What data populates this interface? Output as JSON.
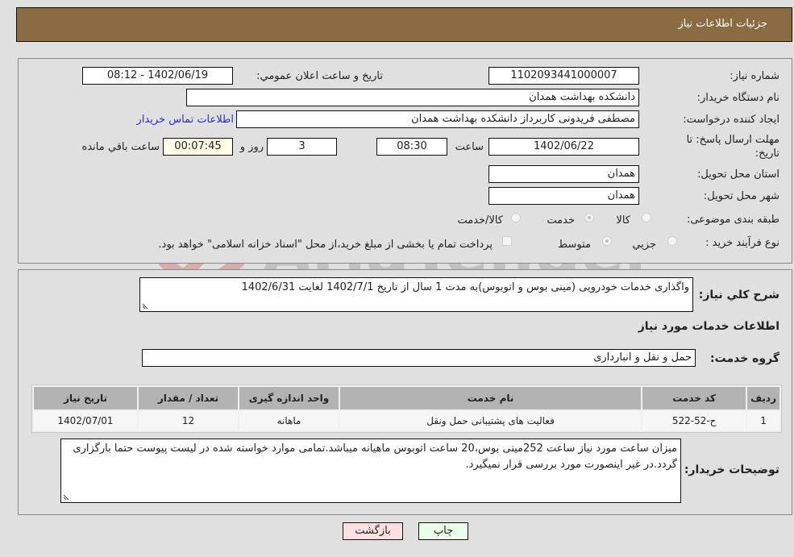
{
  "header": {
    "title": "جزئیات اطلاعات نیاز"
  },
  "details": {
    "need_number": {
      "label": "شماره نیاز:",
      "value": "1102093441000007"
    },
    "announce_datetime": {
      "label": "تاریخ و ساعت اعلان عمومي:",
      "value": "1402/06/19 - 08:12"
    },
    "buyer_org": {
      "label": "نام دستگاه خریدار:",
      "value": "دانشکده بهداشت همدان"
    },
    "requester": {
      "label": "ایجاد کننده درخواست:",
      "value": "مصطفی فریدونی کاربرداز دانشکده بهداشت همدان"
    },
    "buyer_contact_link": "اطلاعات تماس خریدار",
    "deadline": {
      "label_line1": "مهلت ارسال پاسخ: تا",
      "label_line2": "تاریخ:",
      "date": "1402/06/22",
      "time_label": "ساعت",
      "time": "08:30",
      "days": "3",
      "days_label": "روز و",
      "remaining": "00:07:45",
      "remaining_label": "ساعت باقي مانده"
    },
    "province": {
      "label": "استان محل تحویل:",
      "value": "همدان"
    },
    "city": {
      "label": "شهر محل تحویل:",
      "value": "همدان"
    },
    "category": {
      "label": "طبقه بندی موضوعی:",
      "options": [
        "کالا",
        "خدمت",
        "کالا/خدمت"
      ],
      "selected": "خدمت"
    },
    "purchase_process": {
      "label": "نوع فرآیند خرید :",
      "options": [
        "جزيي",
        "متوسط"
      ],
      "selected": "متوسط",
      "treasury_note": "پرداخت تمام یا بخشی از مبلغ خرید،از محل \"اسناد خزانه اسلامی\" خواهد بود."
    }
  },
  "description": {
    "label": "شرح کلي نیاز:",
    "value": "واگذاری خدمات خودرویی (مینی بوس و اتوبوس)به مدت 1 سال از تاریخ 1402/7/1 لغایت 1402/6/31"
  },
  "services_section": {
    "title": "اطلاعات خدمات مورد نیاز",
    "group_label": "گروه خدمت:",
    "group_value": "حمل و نقل و انبارداری",
    "table": {
      "headers": [
        "ردیف",
        "کد خدمت",
        "نام خدمت",
        "واحد اندازه گیری",
        "تعداد / مقدار",
        "تاریخ نیاز"
      ],
      "rows": [
        [
          "1",
          "ح-52-522",
          "فعالیت های پشتیبانی حمل ونقل",
          "ماهانه",
          "12",
          "1402/07/01"
        ]
      ]
    }
  },
  "buyer_notes": {
    "label": "توضیحات خریدار:",
    "value": "میزان ساعت مورد نیاز ساعت 252مینی بوس،20 ساعت اتوبوس ماهیانه میباشد.تمامی موارد خواسته شده در لیست پیوست حتما بارگزاری گردد.در غیر اینصورت مورد بررسی قرار نمیگیرد."
  },
  "buttons": {
    "print": "چاپ",
    "back": "بازگشت"
  },
  "colors": {
    "header_bg": "#8b6c42",
    "back_bg": "#ffe0e0",
    "print_bg": "#eaffea",
    "link": "#2b2bd6"
  }
}
